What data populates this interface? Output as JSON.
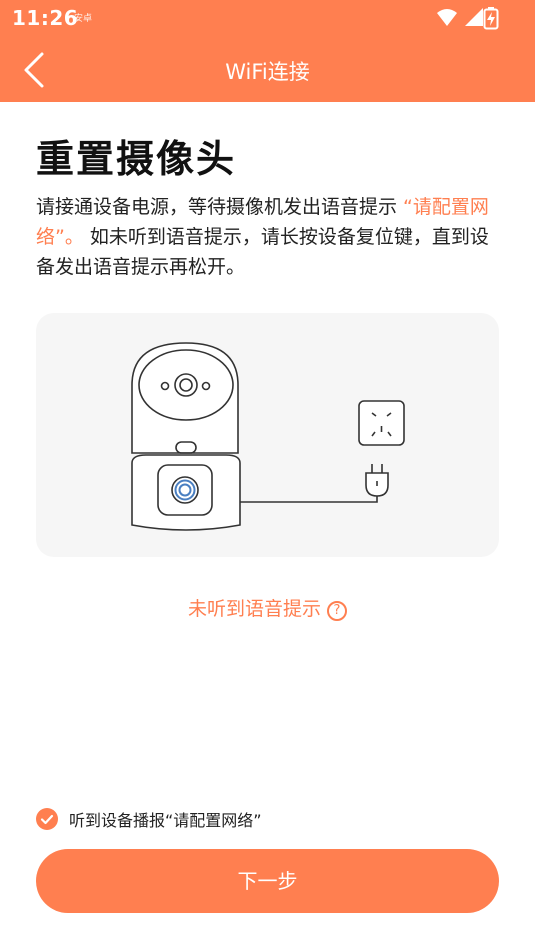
{
  "status_bar": {
    "time": "11:26",
    "carrier": "安卓",
    "icons": [
      "wifi-icon",
      "signal-icon",
      "battery-charging-icon"
    ]
  },
  "app_bar": {
    "title": "WiFi连接",
    "back_icon": "chevron-left-icon"
  },
  "page": {
    "title": "重置摄像头",
    "instruction_prefix": "请接通设备电源，等待摄像机发出语音提示 ",
    "instruction_highlight": "“请配置网络”。",
    "instruction_suffix": " 如未听到语音提示，请长按设备复位键，直到设备发出语音提示再松开。",
    "illustration": "camera-plugged-into-outlet-illustration"
  },
  "no_voice_link": {
    "label": "未听到语音提示",
    "icon": "question-circle-icon",
    "icon_glyph": "?"
  },
  "confirm": {
    "checked": true,
    "label": "听到设备播报“请配置网络”"
  },
  "next_button": {
    "label": "下一步"
  },
  "colors": {
    "accent": "#ff7f50",
    "text_primary": "#111111",
    "background": "#ffffff",
    "illustration_bg": "#f6f6f6"
  }
}
